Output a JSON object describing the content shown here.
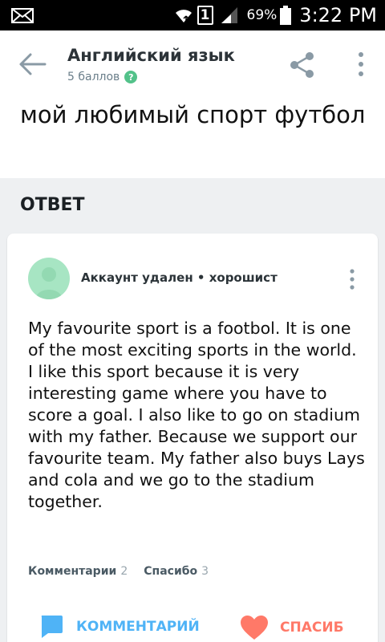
{
  "statusbar": {
    "sim_slot": "1",
    "battery": "69%",
    "time": "3:22 PM",
    "icons": [
      "mail-icon",
      "wifi-icon",
      "signal-icon",
      "battery-icon"
    ]
  },
  "header": {
    "subject": "Английский язык",
    "points": "5 баллов",
    "help_icon": "?"
  },
  "question": {
    "text": "мой любимый спорт футбол"
  },
  "answer_section": {
    "heading": "ОТВЕТ"
  },
  "answer": {
    "author": "Аккаунт удален • хорошист",
    "text": "My favourite sport is a footbol. It is one of the most exciting sports in the world. I like this sport because it is very interesting game where you have to score a goal. I also like to go on stadium with my father. Because we support our favourite team. My father also buys Lays and cola and we go to the stadium together.",
    "comments_label": "Комментарии",
    "comments_count": "2",
    "thanks_label": "Спасибо",
    "thanks_count": "3",
    "comment_button": "КОММЕНТАРИЙ",
    "thanks_button": "СПАСИБ"
  },
  "colors": {
    "accent_blue": "#4fb3f6",
    "accent_red": "#ff7968",
    "help_green": "#53c28a",
    "avatar_green": "#a7e5c3"
  }
}
